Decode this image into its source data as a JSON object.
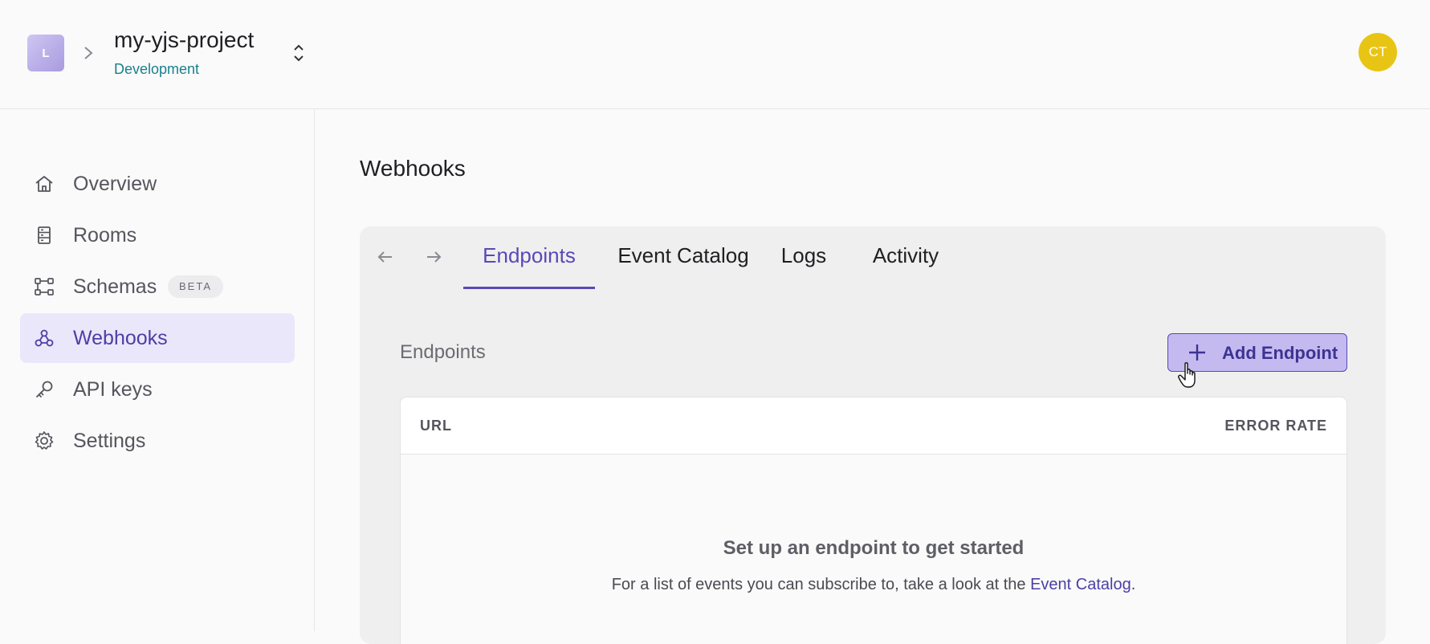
{
  "header": {
    "logo_letter": "L",
    "project_name": "my-yjs-project",
    "environment": "Development",
    "avatar_initials": "CT",
    "avatar_color": "#e8c515"
  },
  "sidebar": {
    "items": [
      {
        "label": "Overview",
        "icon": "home-icon",
        "active": false
      },
      {
        "label": "Rooms",
        "icon": "rooms-icon",
        "active": false
      },
      {
        "label": "Schemas",
        "icon": "schemas-icon",
        "active": false,
        "badge": "BETA"
      },
      {
        "label": "Webhooks",
        "icon": "webhooks-icon",
        "active": true
      },
      {
        "label": "API keys",
        "icon": "key-icon",
        "active": false
      },
      {
        "label": "Settings",
        "icon": "gear-icon",
        "active": false
      }
    ]
  },
  "main": {
    "page_title": "Webhooks",
    "tabs": [
      {
        "label": "Endpoints",
        "active": true
      },
      {
        "label": "Event Catalog",
        "active": false
      },
      {
        "label": "Logs",
        "active": false
      },
      {
        "label": "Activity",
        "active": false
      }
    ],
    "section_title": "Endpoints",
    "add_button_label": "Add Endpoint",
    "table": {
      "columns": [
        "URL",
        "ERROR RATE"
      ]
    },
    "empty_state": {
      "title": "Set up an endpoint to get started",
      "text_before": "For a list of events you can subscribe to, take a look at the ",
      "link_text": "Event Catalog",
      "text_after": "."
    }
  },
  "colors": {
    "accent": "#5a48b8",
    "active_nav_bg": "#ebe7fb",
    "environment_text": "#1a7f8e"
  }
}
